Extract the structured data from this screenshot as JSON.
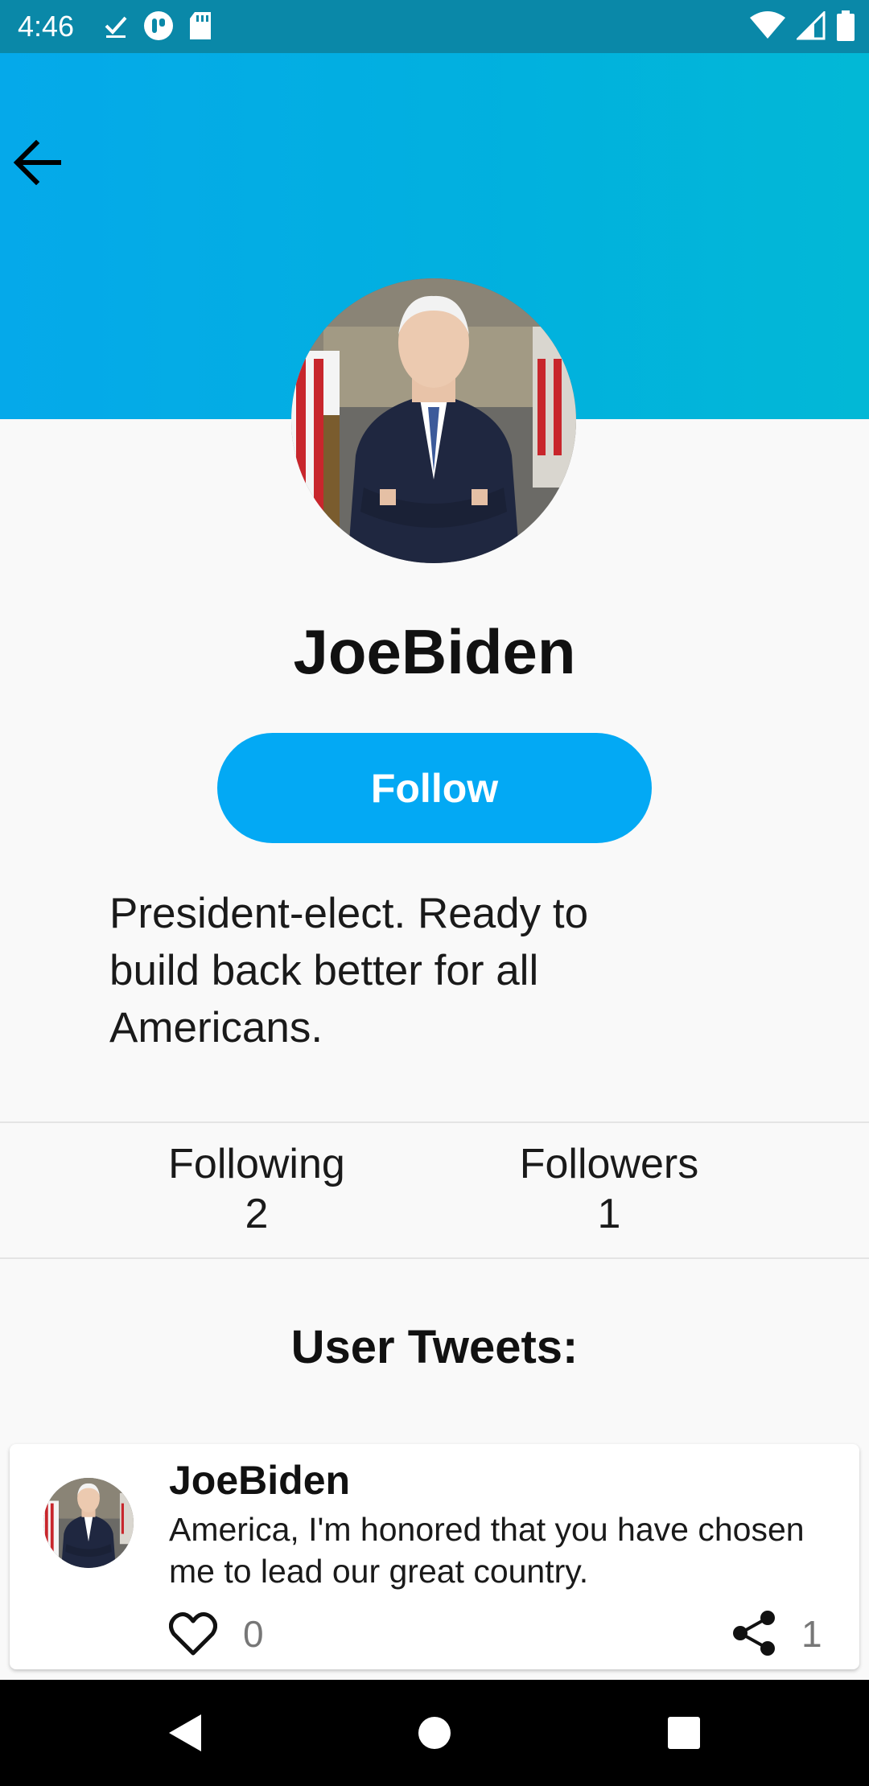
{
  "status_bar": {
    "time": "4:46",
    "icons_left": [
      "download-done-icon",
      "app-notification-icon",
      "sd-card-icon"
    ],
    "icons_right": [
      "wifi-icon",
      "cell-signal-icon",
      "battery-icon"
    ]
  },
  "header": {
    "gradient_from": "#05a9ea",
    "gradient_to": "#02b8d6",
    "back_icon": "arrow-back-icon"
  },
  "profile": {
    "name": "JoeBiden",
    "follow_label": "Follow",
    "bio": "President-elect. Ready to build back better for all Americans.",
    "avatar": "profile-photo"
  },
  "stats": {
    "following_label": "Following",
    "following_value": "2",
    "followers_label": "Followers",
    "followers_value": "1"
  },
  "tweets_section": {
    "title": "User Tweets:",
    "tweets": [
      {
        "author": "JoeBiden",
        "text": "America, I'm honored that you have chosen me to lead our great country.",
        "likes": "0",
        "shares": "1"
      }
    ]
  },
  "nav_bar": {
    "icons": [
      "back-triangle-icon",
      "home-circle-icon",
      "recents-square-icon"
    ]
  },
  "colors": {
    "accent": "#03a9f4",
    "status_bar": "#0a88a8",
    "background": "#f9f9f9"
  }
}
